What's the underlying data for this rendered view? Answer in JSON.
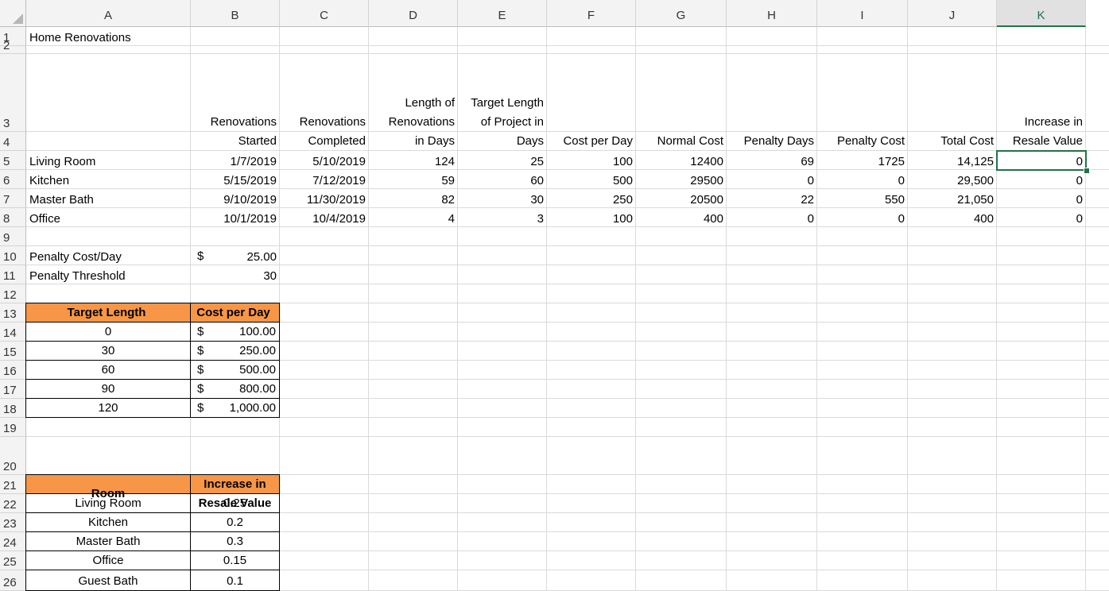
{
  "columns": [
    "A",
    "B",
    "C",
    "D",
    "E",
    "F",
    "G",
    "H",
    "I",
    "J",
    "K"
  ],
  "rows": [
    "1",
    "2",
    "3",
    "4",
    "5",
    "6",
    "7",
    "8",
    "9",
    "10",
    "11",
    "12",
    "13",
    "14",
    "15",
    "16",
    "17",
    "18",
    "19",
    "20",
    "21",
    "22",
    "23",
    "24",
    "25",
    "26"
  ],
  "title": "Home Renovations",
  "headers": {
    "b": [
      "Renovations",
      "Started"
    ],
    "c": [
      "Renovations",
      "Completed"
    ],
    "d": [
      "Length of",
      "Renovations",
      "in Days"
    ],
    "e": [
      "Target Length",
      "of Project in",
      "Days"
    ],
    "f": "Cost per Day",
    "g": "Normal Cost",
    "h": "Penalty Days",
    "i": "Penalty Cost",
    "j": "Total Cost",
    "k": [
      "Increase in",
      "Resale Value"
    ]
  },
  "records": [
    {
      "room": "Living Room",
      "started": "1/7/2019",
      "completed": "5/10/2019",
      "length": "124",
      "target": "25",
      "cost_per_day": "100",
      "normal_cost": "12400",
      "penalty_days": "69",
      "penalty_cost": "1725",
      "total_cost": "14,125",
      "resale": "0"
    },
    {
      "room": "Kitchen",
      "started": "5/15/2019",
      "completed": "7/12/2019",
      "length": "59",
      "target": "60",
      "cost_per_day": "500",
      "normal_cost": "29500",
      "penalty_days": "0",
      "penalty_cost": "0",
      "total_cost": "29,500",
      "resale": "0"
    },
    {
      "room": "Master Bath",
      "started": "9/10/2019",
      "completed": "11/30/2019",
      "length": "82",
      "target": "30",
      "cost_per_day": "250",
      "normal_cost": "20500",
      "penalty_days": "22",
      "penalty_cost": "550",
      "total_cost": "21,050",
      "resale": "0"
    },
    {
      "room": "Office",
      "started": "10/1/2019",
      "completed": "10/4/2019",
      "length": "4",
      "target": "3",
      "cost_per_day": "100",
      "normal_cost": "400",
      "penalty_days": "0",
      "penalty_cost": "0",
      "total_cost": "400",
      "resale": "0"
    }
  ],
  "penalty": {
    "cost_label": "Penalty Cost/Day",
    "cost_symbol": "$",
    "cost_value": "25.00",
    "threshold_label": "Penalty Threshold",
    "threshold_value": "30"
  },
  "cost_table": {
    "headers": [
      "Target Length",
      "Cost per Day"
    ],
    "rows": [
      {
        "length": "0",
        "symbol": "$",
        "cost": "100.00"
      },
      {
        "length": "30",
        "symbol": "$",
        "cost": "250.00"
      },
      {
        "length": "60",
        "symbol": "$",
        "cost": "500.00"
      },
      {
        "length": "90",
        "symbol": "$",
        "cost": "800.00"
      },
      {
        "length": "120",
        "symbol": "$",
        "cost": "1,000.00"
      }
    ]
  },
  "resale_table": {
    "headers": [
      "Room",
      [
        "Increase in",
        "Resale Value"
      ]
    ],
    "rows": [
      {
        "room": "Living Room",
        "value": "0.25"
      },
      {
        "room": "Kitchen",
        "value": "0.2"
      },
      {
        "room": "Master Bath",
        "value": "0.3"
      },
      {
        "room": "Office",
        "value": "0.15"
      },
      {
        "room": "Guest Bath",
        "value": "0.1"
      }
    ]
  },
  "selected_cell": "K4",
  "colors": {
    "accent": "#217346",
    "table_header": "#f79646",
    "header_bg": "#f3f3f3",
    "gridline": "#dadada"
  }
}
